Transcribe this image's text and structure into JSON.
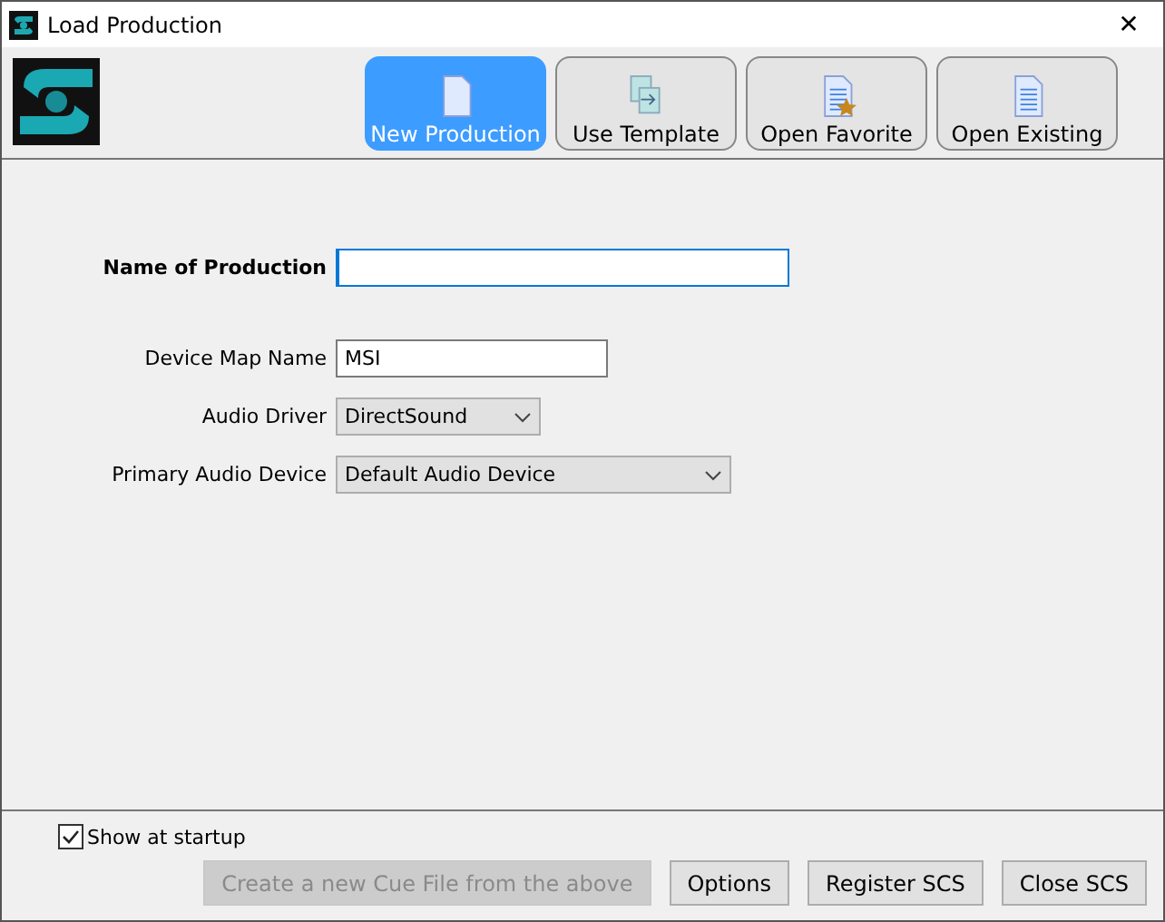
{
  "window": {
    "title": "Load Production",
    "close": "✕"
  },
  "modes": [
    {
      "label": "New Production",
      "kind": "new",
      "selected": true
    },
    {
      "label": "Use Template",
      "kind": "template",
      "selected": false
    },
    {
      "label": "Open Favorite",
      "kind": "favorite",
      "selected": false
    },
    {
      "label": "Open Existing",
      "kind": "existing",
      "selected": false
    }
  ],
  "name_field": {
    "label": "Name of Production"
  },
  "fields": [
    {
      "label": "Device Map Name",
      "kind": "text",
      "value": "MSI"
    },
    {
      "label": "Audio Driver",
      "kind": "dropdown",
      "value": "DirectSound"
    },
    {
      "label": "Primary Audio Device",
      "kind": "dropdown",
      "value": "Default Audio Device"
    }
  ],
  "show_at_startup": {
    "label": "Show at startup",
    "checked": true
  },
  "buttons": [
    {
      "label": "Create a new Cue File from the above",
      "disabled": true
    },
    {
      "label": "Options",
      "disabled": false
    },
    {
      "label": "Register SCS",
      "disabled": false
    },
    {
      "label": "Close SCS",
      "disabled": false
    }
  ]
}
